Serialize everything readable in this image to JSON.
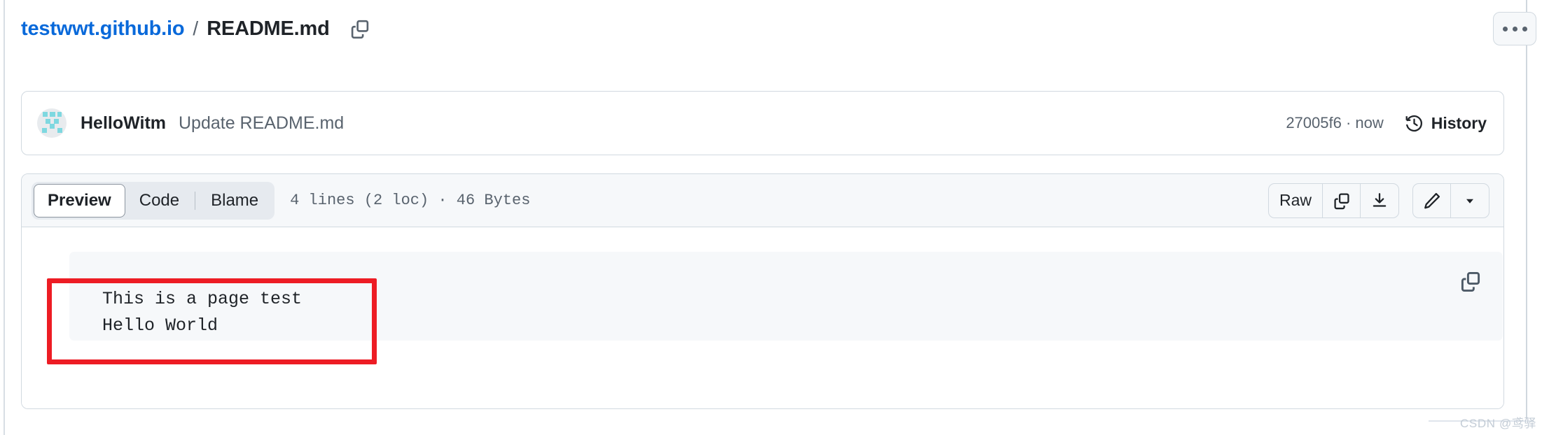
{
  "breadcrumb": {
    "repo": "testwwt.github.io",
    "separator": "/",
    "file": "README.md",
    "copy_icon": "copy-icon"
  },
  "header": {
    "more_button_icon": "kebab-horizontal-icon"
  },
  "commit": {
    "avatar_icon": "user-avatar",
    "author": "HelloWitm",
    "message": "Update README.md",
    "sha_and_time": "27005f6 · now",
    "history_label": "History",
    "history_icon": "history-clock-icon"
  },
  "file_toolbar": {
    "tabs": [
      {
        "label": "Preview",
        "active": true
      },
      {
        "label": "Code",
        "active": false
      },
      {
        "label": "Blame",
        "active": false
      }
    ],
    "meta": "4 lines (2 loc) · 46 Bytes",
    "raw_label": "Raw",
    "copy_icon": "copy-icon",
    "download_icon": "download-icon",
    "edit_icon": "pencil-icon",
    "dropdown_icon": "triangle-down-icon"
  },
  "preview": {
    "code_lines": "This is a page test\nHello World",
    "copy_icon": "copy-icon"
  },
  "annotation": {
    "color": "#ed1c24"
  },
  "watermark": {
    "text": "CSDN @鸢驿"
  }
}
